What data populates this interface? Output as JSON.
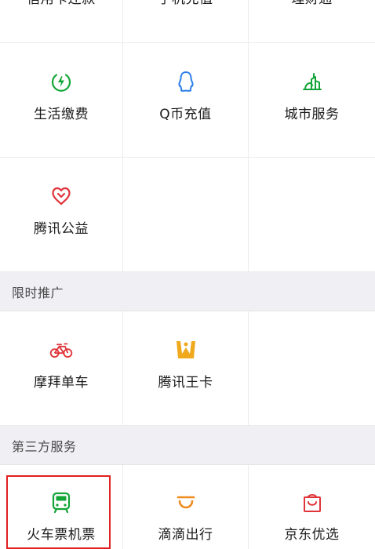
{
  "top_services": {
    "items": [
      {
        "label": "信用卡还款",
        "icon": "credit-card-icon"
      },
      {
        "label": "手机充值",
        "icon": "phone-icon"
      },
      {
        "label": "理财通",
        "icon": "wealth-icon"
      }
    ]
  },
  "services": {
    "items": [
      {
        "label": "生活缴费",
        "icon": "lightning-icon"
      },
      {
        "label": "Q币充值",
        "icon": "penguin-icon"
      },
      {
        "label": "城市服务",
        "icon": "city-icon"
      },
      {
        "label": "腾讯公益",
        "icon": "heart-icon"
      }
    ]
  },
  "promo": {
    "title": "限时推广",
    "items": [
      {
        "label": "摩拜单车",
        "icon": "bicycle-icon"
      },
      {
        "label": "腾讯王卡",
        "icon": "crown-card-icon"
      }
    ]
  },
  "third_party": {
    "title": "第三方服务",
    "items": [
      {
        "label": "火车票机票",
        "icon": "train-icon"
      },
      {
        "label": "滴滴出行",
        "icon": "didi-icon"
      },
      {
        "label": "京东优选",
        "icon": "shopping-bag-icon"
      }
    ]
  },
  "colors": {
    "green": "#13a537",
    "blue": "#2b7de9",
    "red": "#e0343a",
    "gold": "#f0a91d",
    "orange": "#ef8a1f",
    "highlight": "#e02020"
  }
}
